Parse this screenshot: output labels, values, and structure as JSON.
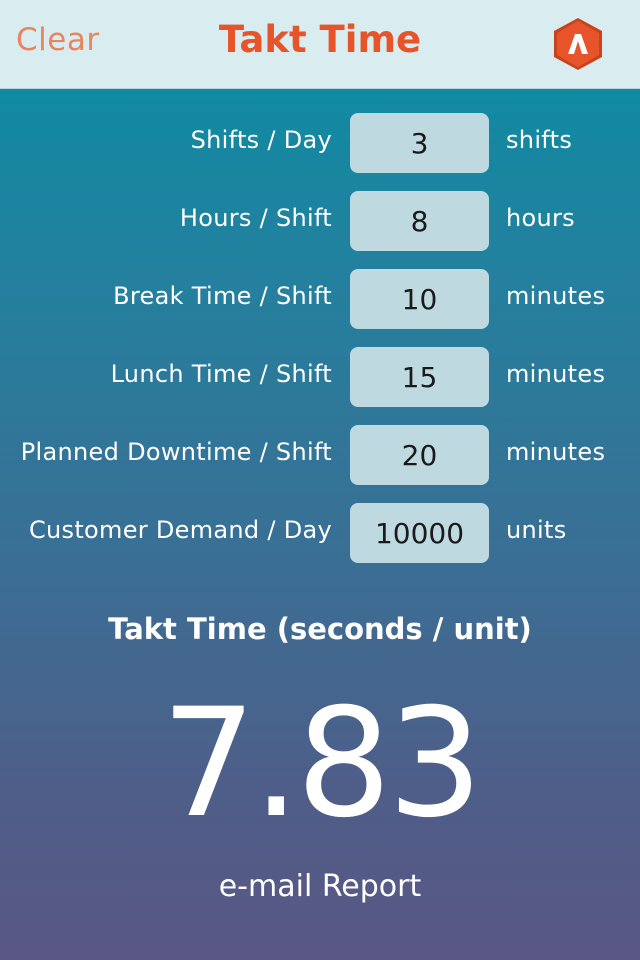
{
  "header": {
    "clear_label": "Clear",
    "title": "Takt Time",
    "logo_icon": "app-logo-icon",
    "logo_colors": {
      "outer": "#e8542a",
      "inner": "#ffffff"
    }
  },
  "form": {
    "rows": [
      {
        "label": "Shifts / Day",
        "value": "3",
        "unit": "shifts"
      },
      {
        "label": "Hours / Shift",
        "value": "8",
        "unit": "hours"
      },
      {
        "label": "Break Time / Shift",
        "value": "10",
        "unit": "minutes"
      },
      {
        "label": "Lunch Time / Shift",
        "value": "15",
        "unit": "minutes"
      },
      {
        "label": "Planned Downtime / Shift",
        "value": "20",
        "unit": "minutes"
      },
      {
        "label": "Customer Demand / Day",
        "value": "10000",
        "unit": "units"
      }
    ]
  },
  "result": {
    "title": "Takt Time (seconds / unit)",
    "value": "7.83"
  },
  "actions": {
    "email_label": "e-mail Report"
  },
  "colors": {
    "accent": "#e8542a",
    "clear": "#e8855f",
    "header_bg": "#d9edf1",
    "input_bg": "#bfd9e1",
    "gradient_top": "#118aa2",
    "gradient_bottom": "#5a5784"
  }
}
